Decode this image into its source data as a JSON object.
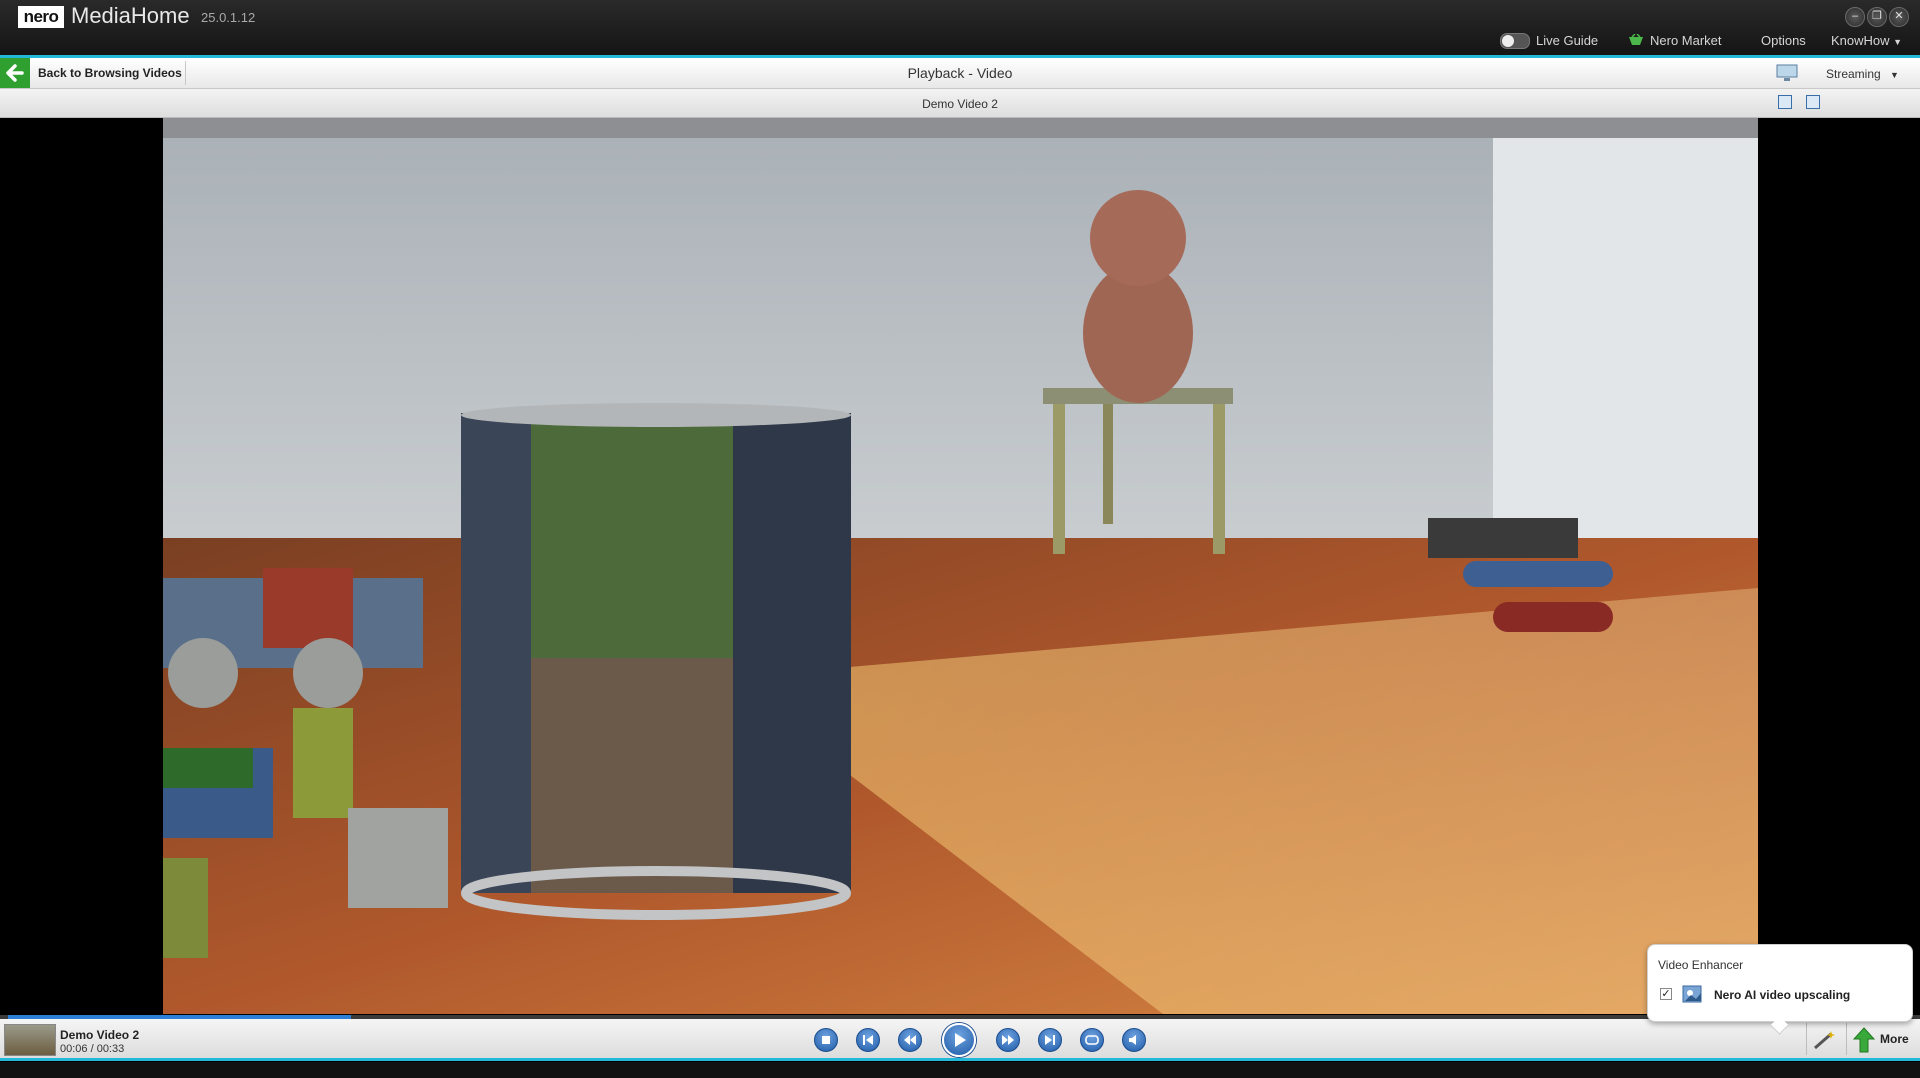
{
  "app": {
    "logo": "nero",
    "name": "MediaHome",
    "version": "25.0.1.12"
  },
  "window_controls": [
    "minimize",
    "restore",
    "close"
  ],
  "top_menu": {
    "live_guide": "Live Guide",
    "nero_market": "Nero Market",
    "options": "Options",
    "knowhow": "KnowHow"
  },
  "nav": {
    "back_label": "Back to Browsing Videos",
    "title": "Playback - Video",
    "streaming": "Streaming"
  },
  "video": {
    "title": "Demo Video 2"
  },
  "now_playing": {
    "title": "Demo Video 2",
    "time": "00:06 / 00:33",
    "progress_fraction": 0.18
  },
  "controls": [
    "stop",
    "previous",
    "rewind",
    "play",
    "fast-forward",
    "next",
    "repeat",
    "volume"
  ],
  "enhancer": {
    "title": "Video Enhancer",
    "option_label": "Nero AI video upscaling",
    "option_checked": true
  },
  "bottom_bar": {
    "more": "More"
  },
  "colors": {
    "accent": "#24b8d8",
    "control_blue": "#1e5aa6",
    "back_green": "#2fa02f"
  }
}
